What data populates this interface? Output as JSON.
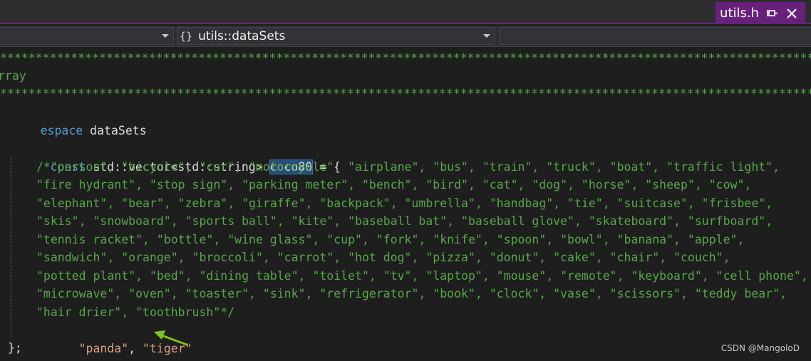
{
  "tab": {
    "title": "utils.h",
    "pin_icon": "pin-icon",
    "close_icon": "close-icon"
  },
  "navbar": {
    "project_combo": "",
    "scope_icon": "{}",
    "scope_combo": "utils::dataSets",
    "member_combo": ""
  },
  "code": {
    "line1": "*****************************************************************************************************************************",
    "line2": "rray",
    "line3": "*****************************************************************************************************************************/",
    "line4_kw": "espace",
    "line4_name": " dataSets",
    "line6_kw": "const",
    "line6_mid": " std::vector<std::string> ",
    "line6_ident": "coco80",
    "line6_end": " = {",
    "comment_lines": [
      "/*\"person\", \"bicycle\", \"car\", \"motorcycle\", \"airplane\", \"bus\", \"train\", \"truck\", \"boat\", \"traffic light\",",
      "\"fire hydrant\", \"stop sign\", \"parking meter\", \"bench\", \"bird\", \"cat\", \"dog\", \"horse\", \"sheep\", \"cow\",",
      "\"elephant\", \"bear\", \"zebra\", \"giraffe\", \"backpack\", \"umbrella\", \"handbag\", \"tie\", \"suitcase\", \"frisbee\",",
      "\"skis\", \"snowboard\", \"sports ball\", \"kite\", \"baseball bat\", \"baseball glove\", \"skateboard\", \"surfboard\",",
      "\"tennis racket\", \"bottle\", \"wine glass\", \"cup\", \"fork\", \"knife\", \"spoon\", \"bowl\", \"banana\", \"apple\",",
      "\"sandwich\", \"orange\", \"broccoli\", \"carrot\", \"hot dog\", \"pizza\", \"donut\", \"cake\", \"chair\", \"couch\",",
      "\"potted plant\", \"bed\", \"dining table\", \"toilet\", \"tv\", \"laptop\", \"mouse\", \"remote\", \"keyboard\", \"cell phone\",",
      "\"microwave\", \"oven\", \"toaster\", \"sink\", \"refrigerator\", \"book\", \"clock\", \"vase\", \"scissors\", \"teddy bear\",",
      "\"hair drier\", \"toothbrush\"*/"
    ],
    "str_panda": "\"panda\"",
    "sep": ", ",
    "str_tiger": "\"tiger\"",
    "closing": "};",
    "partial_line": ""
  },
  "watermark": "CSDN @MangoloD",
  "colors": {
    "background": "#1e1e1e",
    "tab_accent": "#68217a",
    "comment": "#57a64a",
    "keyword": "#569cd6",
    "string": "#d69d85",
    "arrow": "#7fc21b"
  }
}
